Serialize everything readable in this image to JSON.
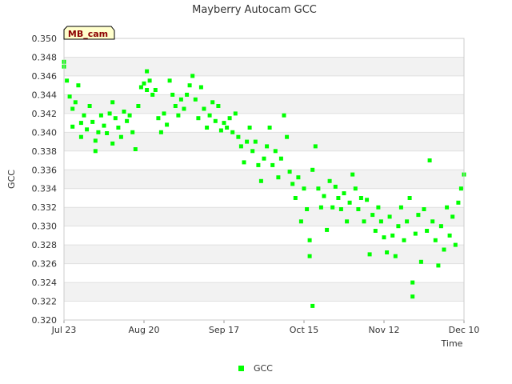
{
  "chart_data": {
    "type": "scatter",
    "title": "Mayberry Autocam GCC",
    "xlabel": "Time",
    "ylabel": "GCC",
    "tag": "MB_cam",
    "x_ticks": [
      "Jul 23",
      "Aug 20",
      "Sep 17",
      "Oct 15",
      "Nov 12",
      "Dec 10"
    ],
    "xlim": [
      "2012-07-23",
      "2012-12-10"
    ],
    "ylim": [
      0.32,
      0.35
    ],
    "y_ticks": [
      "0.320",
      "0.322",
      "0.324",
      "0.326",
      "0.328",
      "0.330",
      "0.332",
      "0.334",
      "0.336",
      "0.338",
      "0.340",
      "0.342",
      "0.344",
      "0.346",
      "0.348",
      "0.350"
    ],
    "grid": "horizontal alternating bands",
    "legend_position": "bottom",
    "colors": {
      "series": "#00ff00",
      "band": "#f2f2f2",
      "tag_fill": "#ffffcc"
    },
    "series": [
      {
        "name": "GCC",
        "points": [
          [
            "2012-07-23",
            0.347
          ],
          [
            "2012-07-23",
            0.3475
          ],
          [
            "2012-07-24",
            0.3455
          ],
          [
            "2012-07-25",
            0.3438
          ],
          [
            "2012-07-26",
            0.3425
          ],
          [
            "2012-07-26",
            0.3406
          ],
          [
            "2012-07-27",
            0.3432
          ],
          [
            "2012-07-28",
            0.345
          ],
          [
            "2012-07-29",
            0.341
          ],
          [
            "2012-07-29",
            0.3395
          ],
          [
            "2012-07-30",
            0.3418
          ],
          [
            "2012-07-31",
            0.3403
          ],
          [
            "2012-08-01",
            0.3428
          ],
          [
            "2012-08-02",
            0.3411
          ],
          [
            "2012-08-03",
            0.3391
          ],
          [
            "2012-08-03",
            0.338
          ],
          [
            "2012-08-04",
            0.34
          ],
          [
            "2012-08-05",
            0.3418
          ],
          [
            "2012-08-06",
            0.3407
          ],
          [
            "2012-08-07",
            0.3399
          ],
          [
            "2012-08-08",
            0.342
          ],
          [
            "2012-08-09",
            0.3432
          ],
          [
            "2012-08-09",
            0.3388
          ],
          [
            "2012-08-10",
            0.3415
          ],
          [
            "2012-08-11",
            0.3405
          ],
          [
            "2012-08-12",
            0.3395
          ],
          [
            "2012-08-13",
            0.3422
          ],
          [
            "2012-08-14",
            0.3412
          ],
          [
            "2012-08-15",
            0.3418
          ],
          [
            "2012-08-16",
            0.34
          ],
          [
            "2012-08-17",
            0.3382
          ],
          [
            "2012-08-18",
            0.3428
          ],
          [
            "2012-08-19",
            0.3448
          ],
          [
            "2012-08-20",
            0.3452
          ],
          [
            "2012-08-21",
            0.3465
          ],
          [
            "2012-08-21",
            0.3445
          ],
          [
            "2012-08-22",
            0.3455
          ],
          [
            "2012-08-23",
            0.344
          ],
          [
            "2012-08-24",
            0.3445
          ],
          [
            "2012-08-25",
            0.3415
          ],
          [
            "2012-08-26",
            0.34
          ],
          [
            "2012-08-27",
            0.342
          ],
          [
            "2012-08-28",
            0.3408
          ],
          [
            "2012-08-29",
            0.3455
          ],
          [
            "2012-08-30",
            0.344
          ],
          [
            "2012-08-31",
            0.3428
          ],
          [
            "2012-09-01",
            0.3418
          ],
          [
            "2012-09-02",
            0.3435
          ],
          [
            "2012-09-03",
            0.3425
          ],
          [
            "2012-09-04",
            0.344
          ],
          [
            "2012-09-05",
            0.345
          ],
          [
            "2012-09-06",
            0.346
          ],
          [
            "2012-09-07",
            0.3435
          ],
          [
            "2012-09-08",
            0.3415
          ],
          [
            "2012-09-09",
            0.3448
          ],
          [
            "2012-09-10",
            0.3425
          ],
          [
            "2012-09-11",
            0.3405
          ],
          [
            "2012-09-12",
            0.3418
          ],
          [
            "2012-09-13",
            0.3432
          ],
          [
            "2012-09-14",
            0.3412
          ],
          [
            "2012-09-15",
            0.3428
          ],
          [
            "2012-09-16",
            0.3402
          ],
          [
            "2012-09-17",
            0.341
          ],
          [
            "2012-09-18",
            0.3405
          ],
          [
            "2012-09-19",
            0.3415
          ],
          [
            "2012-09-20",
            0.34
          ],
          [
            "2012-09-21",
            0.342
          ],
          [
            "2012-09-22",
            0.3395
          ],
          [
            "2012-09-23",
            0.3385
          ],
          [
            "2012-09-24",
            0.3368
          ],
          [
            "2012-09-25",
            0.339
          ],
          [
            "2012-09-26",
            0.3405
          ],
          [
            "2012-09-27",
            0.338
          ],
          [
            "2012-09-28",
            0.339
          ],
          [
            "2012-09-29",
            0.3365
          ],
          [
            "2012-09-30",
            0.3348
          ],
          [
            "2012-10-01",
            0.3372
          ],
          [
            "2012-10-02",
            0.3385
          ],
          [
            "2012-10-03",
            0.3405
          ],
          [
            "2012-10-04",
            0.3365
          ],
          [
            "2012-10-05",
            0.338
          ],
          [
            "2012-10-06",
            0.3352
          ],
          [
            "2012-10-07",
            0.3372
          ],
          [
            "2012-10-08",
            0.3418
          ],
          [
            "2012-10-09",
            0.3395
          ],
          [
            "2012-10-10",
            0.3358
          ],
          [
            "2012-10-11",
            0.3345
          ],
          [
            "2012-10-12",
            0.333
          ],
          [
            "2012-10-13",
            0.3352
          ],
          [
            "2012-10-14",
            0.3305
          ],
          [
            "2012-10-15",
            0.334
          ],
          [
            "2012-10-16",
            0.3318
          ],
          [
            "2012-10-17",
            0.3285
          ],
          [
            "2012-10-17",
            0.3268
          ],
          [
            "2012-10-18",
            0.336
          ],
          [
            "2012-10-18",
            0.3215
          ],
          [
            "2012-10-19",
            0.3385
          ],
          [
            "2012-10-20",
            0.334
          ],
          [
            "2012-10-21",
            0.332
          ],
          [
            "2012-10-22",
            0.3332
          ],
          [
            "2012-10-23",
            0.3296
          ],
          [
            "2012-10-24",
            0.3348
          ],
          [
            "2012-10-25",
            0.332
          ],
          [
            "2012-10-26",
            0.3342
          ],
          [
            "2012-10-27",
            0.333
          ],
          [
            "2012-10-28",
            0.3318
          ],
          [
            "2012-10-29",
            0.3335
          ],
          [
            "2012-10-30",
            0.3305
          ],
          [
            "2012-10-31",
            0.3325
          ],
          [
            "2012-11-01",
            0.3355
          ],
          [
            "2012-11-02",
            0.334
          ],
          [
            "2012-11-03",
            0.3318
          ],
          [
            "2012-11-04",
            0.333
          ],
          [
            "2012-11-05",
            0.3305
          ],
          [
            "2012-11-06",
            0.3328
          ],
          [
            "2012-11-07",
            0.327
          ],
          [
            "2012-11-08",
            0.3312
          ],
          [
            "2012-11-09",
            0.3295
          ],
          [
            "2012-11-10",
            0.332
          ],
          [
            "2012-11-11",
            0.3305
          ],
          [
            "2012-11-12",
            0.3288
          ],
          [
            "2012-11-13",
            0.3272
          ],
          [
            "2012-11-14",
            0.331
          ],
          [
            "2012-11-15",
            0.329
          ],
          [
            "2012-11-16",
            0.3268
          ],
          [
            "2012-11-17",
            0.33
          ],
          [
            "2012-11-18",
            0.332
          ],
          [
            "2012-11-19",
            0.3285
          ],
          [
            "2012-11-20",
            0.3305
          ],
          [
            "2012-11-21",
            0.333
          ],
          [
            "2012-11-22",
            0.324
          ],
          [
            "2012-11-22",
            0.3225
          ],
          [
            "2012-11-23",
            0.3292
          ],
          [
            "2012-11-24",
            0.3312
          ],
          [
            "2012-11-25",
            0.3262
          ],
          [
            "2012-11-26",
            0.3318
          ],
          [
            "2012-11-27",
            0.3295
          ],
          [
            "2012-11-28",
            0.337
          ],
          [
            "2012-11-29",
            0.3305
          ],
          [
            "2012-11-30",
            0.3285
          ],
          [
            "2012-12-01",
            0.3258
          ],
          [
            "2012-12-02",
            0.33
          ],
          [
            "2012-12-03",
            0.3275
          ],
          [
            "2012-12-04",
            0.332
          ],
          [
            "2012-12-05",
            0.329
          ],
          [
            "2012-12-06",
            0.331
          ],
          [
            "2012-12-07",
            0.328
          ],
          [
            "2012-12-08",
            0.3325
          ],
          [
            "2012-12-09",
            0.334
          ],
          [
            "2012-12-10",
            0.3355
          ]
        ]
      }
    ]
  }
}
